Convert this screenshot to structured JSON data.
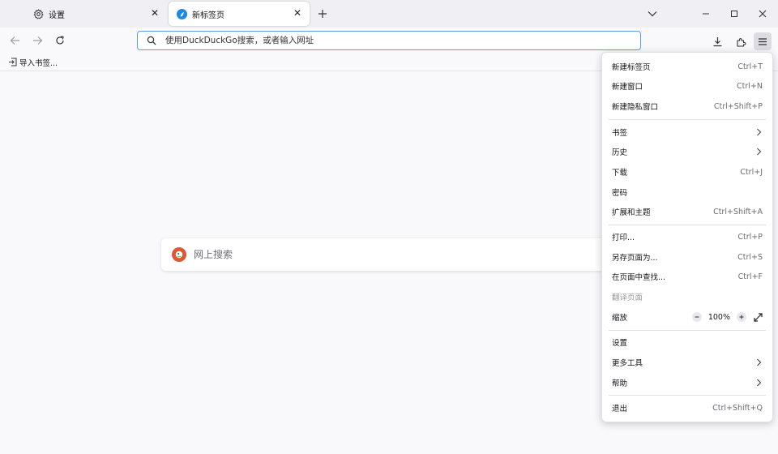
{
  "tabs": [
    {
      "title": "设置",
      "icon": "gear-icon"
    },
    {
      "title": "新标签页",
      "icon": "firefox-icon",
      "active": true
    }
  ],
  "url_bar": {
    "placeholder": "使用DuckDuckGo搜索，或者输入网址",
    "value": ""
  },
  "bookmarks_bar": {
    "import_label": "导入书签..."
  },
  "content_search": {
    "placeholder": "网上搜索"
  },
  "app_menu": {
    "items": [
      {
        "label": "新建标签页",
        "shortcut": "Ctrl+T"
      },
      {
        "label": "新建窗口",
        "shortcut": "Ctrl+N"
      },
      {
        "label": "新建隐私窗口",
        "shortcut": "Ctrl+Shift+P"
      },
      {
        "label": "书签",
        "shortcut": ""
      },
      {
        "label": "历史",
        "shortcut": ""
      },
      {
        "label": "下载",
        "shortcut": "Ctrl+J"
      },
      {
        "label": "密码",
        "shortcut": ""
      },
      {
        "label": "扩展和主题",
        "shortcut": "Ctrl+Shift+A"
      },
      {
        "label": "打印...",
        "shortcut": "Ctrl+P"
      },
      {
        "label": "另存页面为...",
        "shortcut": "Ctrl+S"
      },
      {
        "label": "在页面中查找...",
        "shortcut": "Ctrl+F"
      },
      {
        "label": "翻译页面",
        "shortcut": "",
        "disabled": true
      },
      {
        "label": "缩放",
        "zoom": "100%"
      },
      {
        "label": "设置",
        "shortcut": ""
      },
      {
        "label": "更多工具",
        "shortcut": ""
      },
      {
        "label": "帮助",
        "shortcut": ""
      },
      {
        "label": "退出",
        "shortcut": "Ctrl+Shift+Q"
      }
    ]
  },
  "colors": {
    "accent": "#5aa0e6",
    "ddg": "#de5833",
    "firefox": "#1e88e5"
  }
}
